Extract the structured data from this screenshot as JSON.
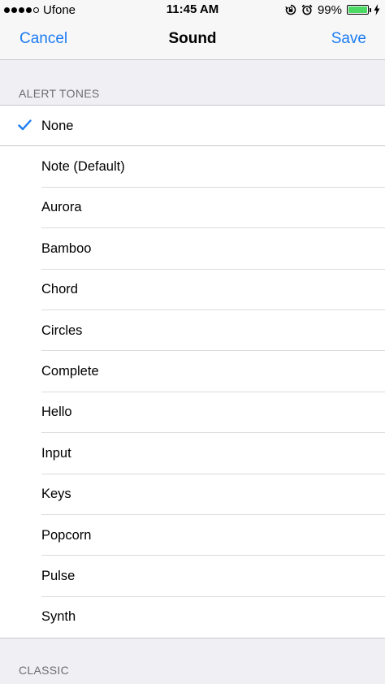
{
  "status_bar": {
    "carrier": "Ufone",
    "time": "11:45 AM",
    "battery_percent": "99%",
    "battery_level": 0.99,
    "signal_strength": 4,
    "icons": [
      "rotation-lock-icon",
      "alarm-icon",
      "battery-icon",
      "charging-icon"
    ]
  },
  "nav": {
    "cancel_label": "Cancel",
    "title": "Sound",
    "save_label": "Save"
  },
  "sections": {
    "alert_tones_header": "ALERT TONES",
    "classic_header": "CLASSIC"
  },
  "alert_tones": {
    "selected": "None",
    "items": [
      {
        "label": "None"
      },
      {
        "label": "Note (Default)"
      },
      {
        "label": "Aurora"
      },
      {
        "label": "Bamboo"
      },
      {
        "label": "Chord"
      },
      {
        "label": "Circles"
      },
      {
        "label": "Complete"
      },
      {
        "label": "Hello"
      },
      {
        "label": "Input"
      },
      {
        "label": "Keys"
      },
      {
        "label": "Popcorn"
      },
      {
        "label": "Pulse"
      },
      {
        "label": "Synth"
      }
    ]
  },
  "colors": {
    "accent": "#1b7cf2",
    "background": "#efeff4",
    "battery_fill": "#4cd964",
    "section_text": "#6d6d72"
  }
}
